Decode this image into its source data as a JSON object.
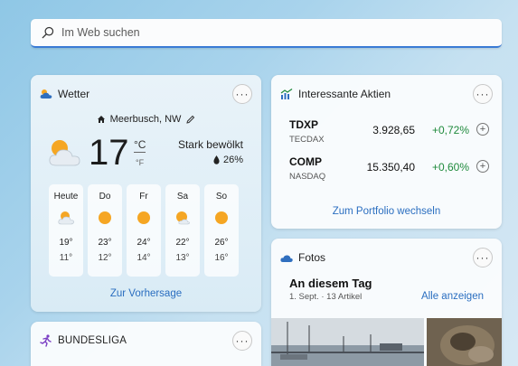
{
  "search": {
    "placeholder": "Im Web suchen"
  },
  "weather": {
    "title": "Wetter",
    "location": "Meerbusch, NW",
    "temperature": "17",
    "unit_c": "°C",
    "unit_f": "°F",
    "condition": "Stark bewölkt",
    "humidity": "26%",
    "forecast": [
      {
        "day": "Heute",
        "high": "19°",
        "low": "11°",
        "icon": "partly-cloudy-icon"
      },
      {
        "day": "Do",
        "high": "23°",
        "low": "12°",
        "icon": "sun-icon"
      },
      {
        "day": "Fr",
        "high": "24°",
        "low": "14°",
        "icon": "sun-icon"
      },
      {
        "day": "Sa",
        "high": "22°",
        "low": "13°",
        "icon": "sun-cloud-icon"
      },
      {
        "day": "So",
        "high": "26°",
        "low": "16°",
        "icon": "sun-icon"
      }
    ],
    "link": "Zur Vorhersage"
  },
  "stocks": {
    "title": "Interessante Aktien",
    "items": [
      {
        "symbol": "TDXP",
        "exchange": "TECDAX",
        "price": "3.928,65",
        "change": "+0,72%"
      },
      {
        "symbol": "COMP",
        "exchange": "NASDAQ",
        "price": "15.350,40",
        "change": "+0,60%"
      }
    ],
    "link": "Zum Portfolio wechseln"
  },
  "photos": {
    "title": "Fotos",
    "heading": "An diesem Tag",
    "subtitle": "1. Sept. · 13 Artikel",
    "link": "Alle anzeigen"
  },
  "bundesliga": {
    "title": "BUNDESLIGA"
  },
  "colors": {
    "accent": "#2a6ec0",
    "positive": "#1f8a3c",
    "sun": "#f5a623"
  },
  "more_label": "···"
}
